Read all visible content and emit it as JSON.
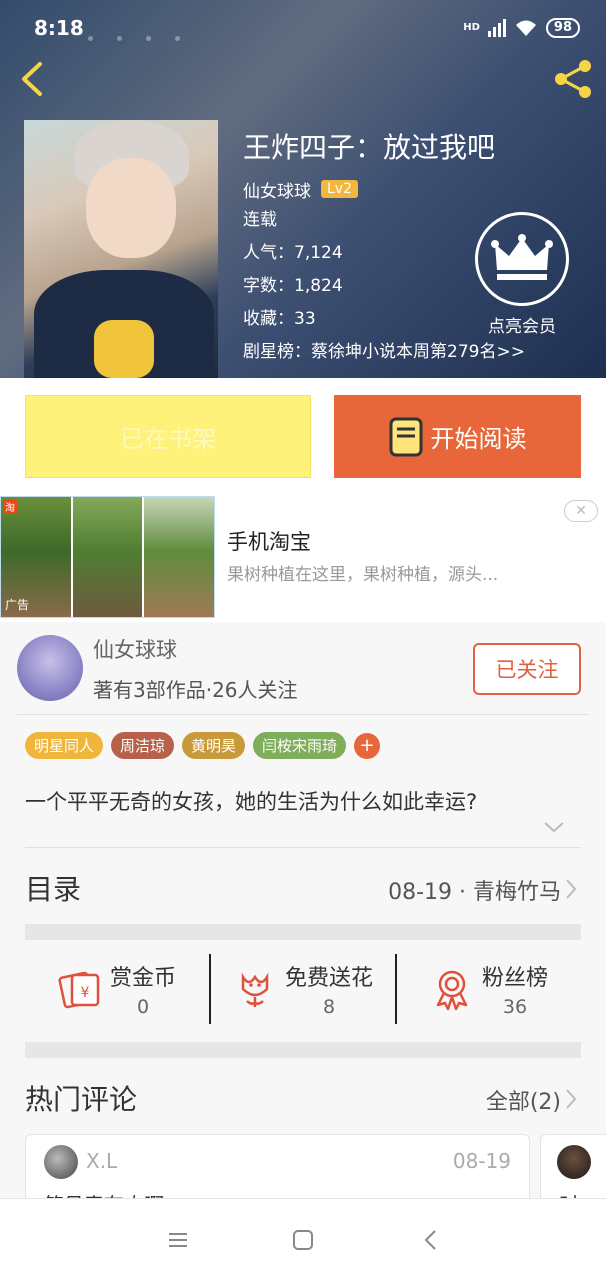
{
  "status_bar": {
    "time": "8:18",
    "network_label": "HD",
    "battery": "98"
  },
  "book": {
    "title": "王炸四子：放过我吧",
    "author": "仙女球球",
    "author_level": "Lv2",
    "status": "连载",
    "popularity": "人气：7,124",
    "word_count": "字数：1,824",
    "favorites": "收藏：33",
    "rank": "剧星榜：蔡徐坤小说本周第279名>>"
  },
  "vip": {
    "label": "点亮会员"
  },
  "actions": {
    "shelf_label": "已在书架",
    "read_label": "开始阅读"
  },
  "ad": {
    "app_tag": "淘",
    "mark": "广告",
    "title": "手机淘宝",
    "description": "果树种植在这里，果树种植，源头..."
  },
  "author_card": {
    "name": "仙女球球",
    "meta": "著有3部作品·26人关注",
    "follow_label": "已关注"
  },
  "tags": [
    {
      "label": "明星同人",
      "color": "#f0b53d"
    },
    {
      "label": "周洁琼",
      "color": "#b8614a"
    },
    {
      "label": "黄明昊",
      "color": "#c99a3a"
    },
    {
      "label": "闫桉宋雨琦",
      "color": "#7fae5a"
    }
  ],
  "tag_add": "+",
  "synopsis": "一个平平无奇的女孩，她的生活为什么如此幸运?",
  "toc": {
    "title": "目录",
    "latest": "08-19 · 青梅竹马"
  },
  "stats": [
    {
      "label": "赏金币",
      "value": "0",
      "icon": "red-envelope-icon"
    },
    {
      "label": "免费送花",
      "value": "8",
      "icon": "flower-icon"
    },
    {
      "label": "粉丝榜",
      "value": "36",
      "icon": "medal-icon"
    }
  ],
  "comments": {
    "title": "热门评论",
    "all_label": "全部(2)",
    "items": [
      {
        "user": "X.L",
        "date": "08-19",
        "text": "简号竟有肉啊"
      },
      {
        "user": "",
        "date": "",
        "text": "时"
      }
    ]
  },
  "colors": {
    "accent": "#e8673a",
    "shelf": "#fef27a",
    "gold": "#f3b73d"
  }
}
